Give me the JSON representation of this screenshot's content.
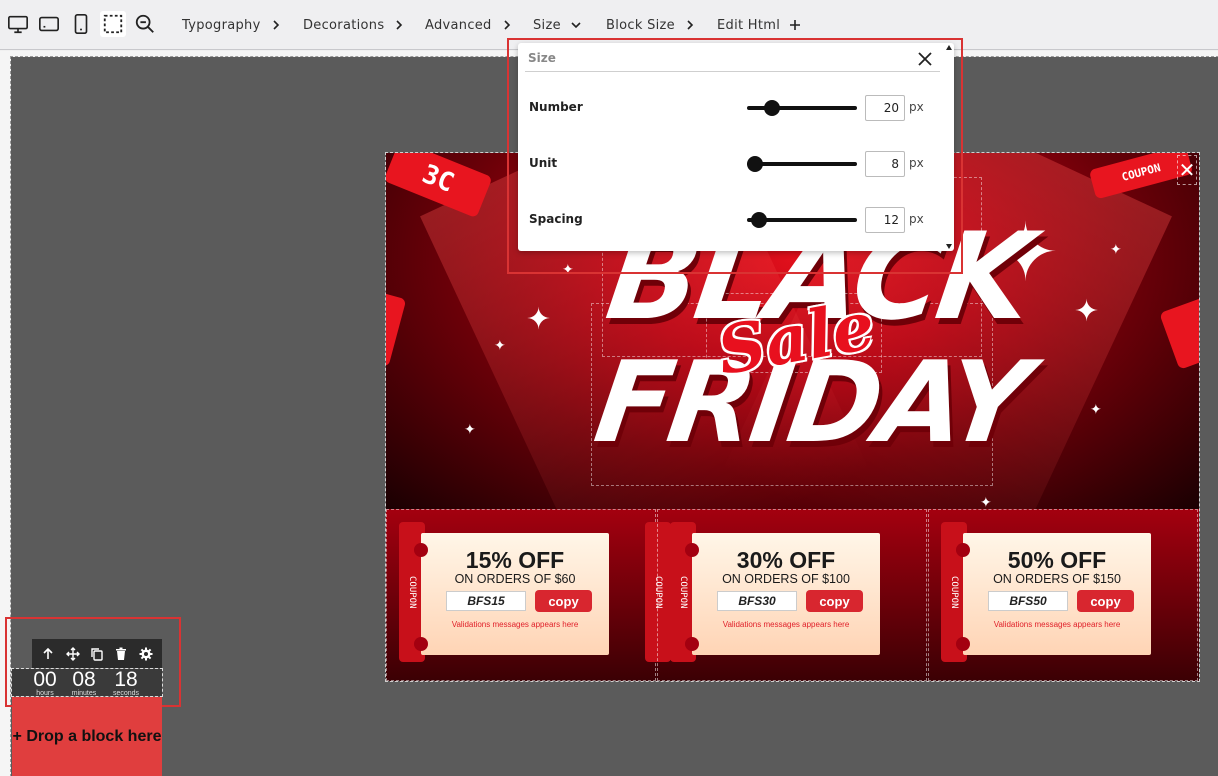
{
  "toolbar": {
    "device_icons": [
      "desktop-icon",
      "tablet-landscape-icon",
      "mobile-icon",
      "select-area-icon",
      "zoom-out-icon"
    ],
    "menus": [
      {
        "label": "Typography",
        "indicator": "chevron-right"
      },
      {
        "label": "Decorations",
        "indicator": "chevron-right"
      },
      {
        "label": "Advanced",
        "indicator": "chevron-right"
      },
      {
        "label": "Size",
        "indicator": "chevron-down"
      },
      {
        "label": "Block Size",
        "indicator": "chevron-right"
      },
      {
        "label": "Edit Html",
        "indicator": "plus"
      }
    ]
  },
  "size_panel": {
    "title": "Size",
    "rows": [
      {
        "label": "Number",
        "value": "20",
        "unit": "px",
        "slider_fraction": 0.18
      },
      {
        "label": "Unit",
        "value": "8",
        "unit": "px",
        "slider_fraction": 0.0
      },
      {
        "label": "Spacing",
        "value": "12",
        "unit": "px",
        "slider_fraction": 0.04
      }
    ]
  },
  "banner": {
    "headline_top": "BLACK",
    "headline_script": "Sale",
    "headline_bottom": "FRIDAY",
    "close_symbol": "✕",
    "coupons": [
      {
        "discount": "15% OFF",
        "condition": "ON ORDERS OF $60",
        "code": "BFS15",
        "button": "copy",
        "validation": "Validations messages appears here"
      },
      {
        "discount": "30% OFF",
        "condition": "ON ORDERS OF $100",
        "code": "BFS30",
        "button": "copy",
        "validation": "Validations messages appears here"
      },
      {
        "discount": "50% OFF",
        "condition": "ON ORDERS OF $150",
        "code": "BFS50",
        "button": "copy",
        "validation": "Validations messages appears here"
      }
    ]
  },
  "block_toolbar": {
    "actions": [
      "arrow-up-icon",
      "move-icon",
      "duplicate-icon",
      "delete-icon",
      "settings-icon"
    ]
  },
  "timer": {
    "hours": "00",
    "hours_label": "hours",
    "minutes": "08",
    "minutes_label": "minutes",
    "seconds": "18",
    "seconds_label": "seconds"
  },
  "drop_block": {
    "label": "+ Drop a block here"
  },
  "colors": {
    "accent": "#d93333",
    "coupon_button": "#d8262f",
    "canvas": "#5b5b5b"
  }
}
